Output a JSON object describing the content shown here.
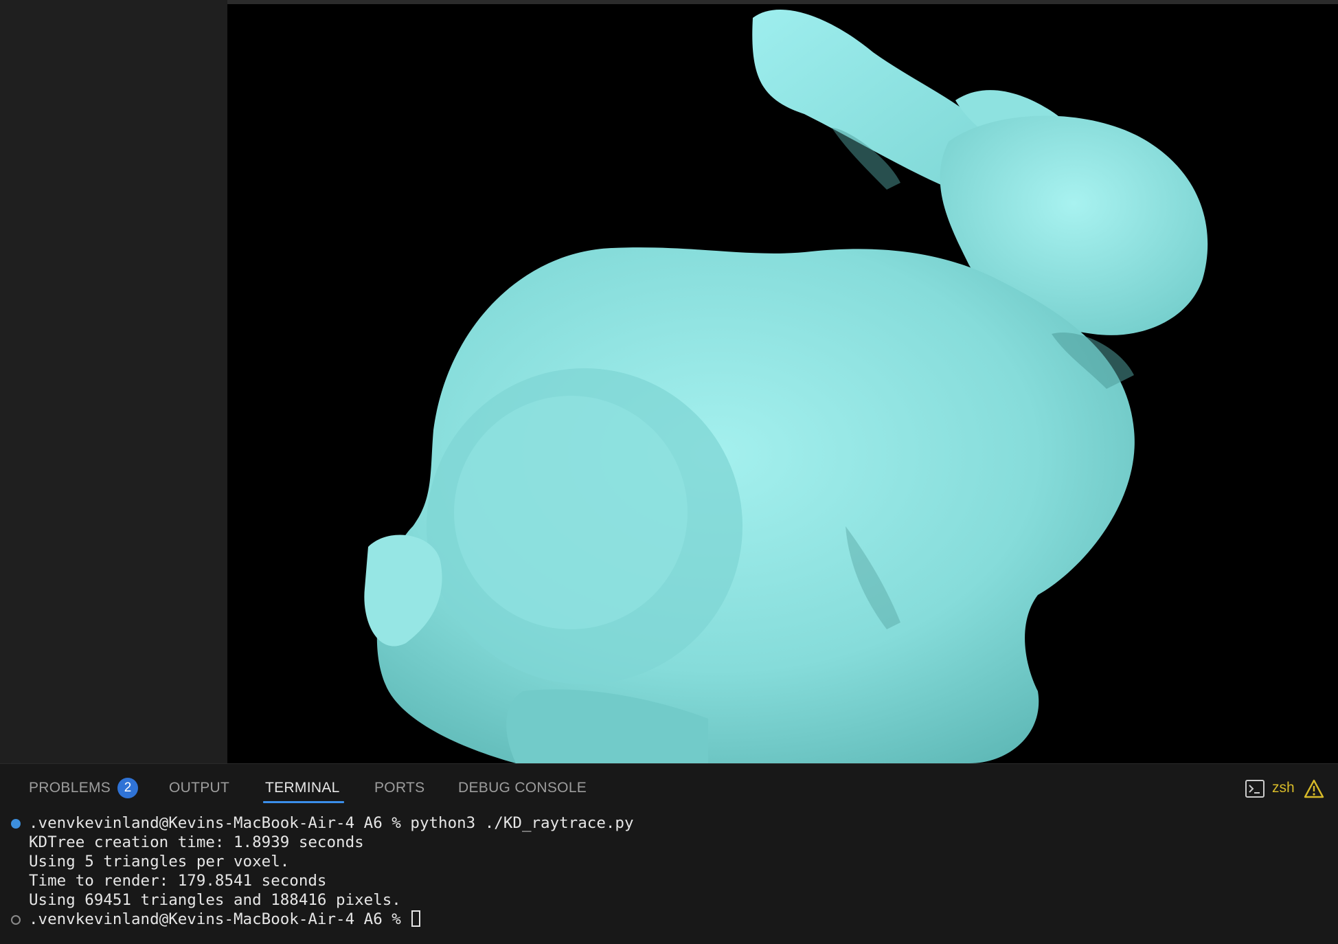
{
  "panel": {
    "tabs": [
      {
        "label": "PROBLEMS",
        "active": false
      },
      {
        "label": "OUTPUT",
        "active": false
      },
      {
        "label": "TERMINAL",
        "active": true
      },
      {
        "label": "PORTS",
        "active": false
      },
      {
        "label": "DEBUG CONSOLE",
        "active": false
      }
    ],
    "problems_count": "2",
    "shell_name": "zsh",
    "icons": [
      "terminal-icon",
      "warning-icon"
    ],
    "accent_color": "#3b8eea",
    "warning_color": "#d7ba29"
  },
  "terminal": {
    "lines": [
      ".venvkevinland@Kevins-MacBook-Air-4 A6 % python3 ./KD_raytrace.py",
      "KDTree creation time: 1.8939 seconds",
      "Using 5 triangles per voxel.",
      "Time to render: 179.8541 seconds",
      "Using 69451 triangles and 188416 pixels.",
      ".venvkevinland@Kevins-MacBook-Air-4 A6 % "
    ]
  },
  "render": {
    "subject_icon": "rabbit-render",
    "model_color": "#8fe3e3",
    "background_color": "#000000"
  }
}
